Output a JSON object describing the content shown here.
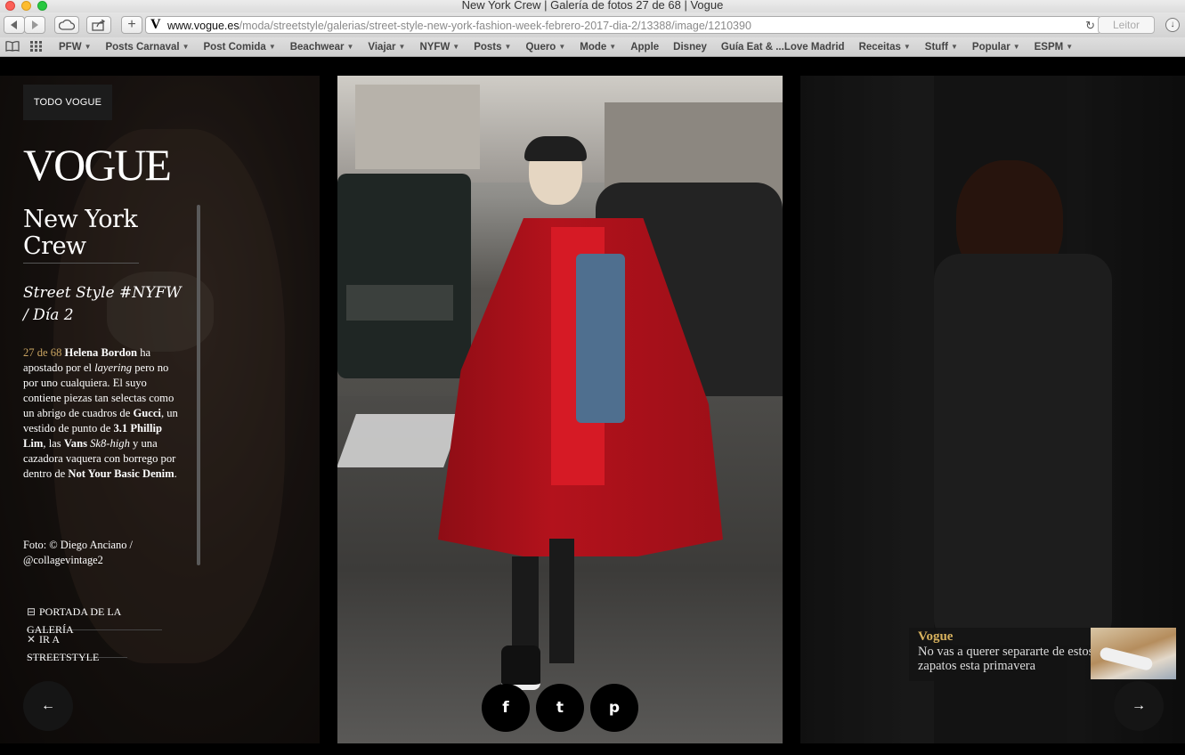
{
  "browser": {
    "window_title": "New York Crew | Galería de fotos 27 de 68 | Vogue",
    "url_host": "www.vogue.es",
    "url_path": "/moda/streetstyle/galerias/street-style-new-york-fashion-week-febrero-2017-dia-2/13388/image/1210390",
    "reader_label": "Leitor",
    "bookmarks": [
      {
        "label": "PFW",
        "menu": true
      },
      {
        "label": "Posts Carnaval",
        "menu": true
      },
      {
        "label": "Post Comida",
        "menu": true
      },
      {
        "label": "Beachwear",
        "menu": true
      },
      {
        "label": "Viajar",
        "menu": true
      },
      {
        "label": "NYFW",
        "menu": true
      },
      {
        "label": "Posts",
        "menu": true
      },
      {
        "label": "Quero",
        "menu": true
      },
      {
        "label": "Mode",
        "menu": true
      },
      {
        "label": "Apple",
        "menu": false
      },
      {
        "label": "Disney",
        "menu": false
      },
      {
        "label": "Guía Eat & ...Love Madrid",
        "menu": false
      },
      {
        "label": "Receitas",
        "menu": true
      },
      {
        "label": "Stuff",
        "menu": true
      },
      {
        "label": "Popular",
        "menu": true
      },
      {
        "label": "ESPM",
        "menu": true
      }
    ]
  },
  "gallery": {
    "todo_button": "TODO VOGUE",
    "logo": "VOGUE",
    "title": "New York Crew",
    "subtitle": "Street Style #NYFW / Día 2",
    "counter": "27 de 68",
    "description": {
      "name": "Helena Bordon",
      "t1": " ha apostado por el ",
      "em1": "layering",
      "t2": " pero no por uno cualquiera. El suyo contiene piezas tan selectas como un abrigo de cuadros de ",
      "b1": "Gucci",
      "t3": ", un vestido de punto de ",
      "b2": "3.1 Phillip Lim",
      "t4": ", las ",
      "b3": "Vans",
      "em2": "Sk8-high",
      "t5": " y una cazadora vaquera con borrego por dentro de ",
      "b4": "Not Your Basic Denim",
      "t6": "."
    },
    "credit": "Foto: © Diego Anciano / @collagevintage2",
    "nav_portada": "PORTADA DE LA GALERÍA",
    "nav_streetstyle": "IR A STREETSTYLE"
  },
  "promo": {
    "brand": "Vogue",
    "text": "No vas a querer separarte de estos zapatos esta primavera"
  },
  "colors": {
    "accent_gold": "#c9a461",
    "promo_gold": "#d8b25e",
    "coat_red": "#b3121c"
  },
  "icons": [
    "book-icon",
    "grid-icon",
    "back-icon",
    "forward-icon",
    "cloud-icon",
    "share-icon",
    "plus-icon",
    "reload-icon",
    "download-icon",
    "arrow-left-icon",
    "arrow-right-icon",
    "facebook-icon",
    "twitter-icon",
    "pinterest-icon",
    "minus-square-icon",
    "close-icon"
  ]
}
